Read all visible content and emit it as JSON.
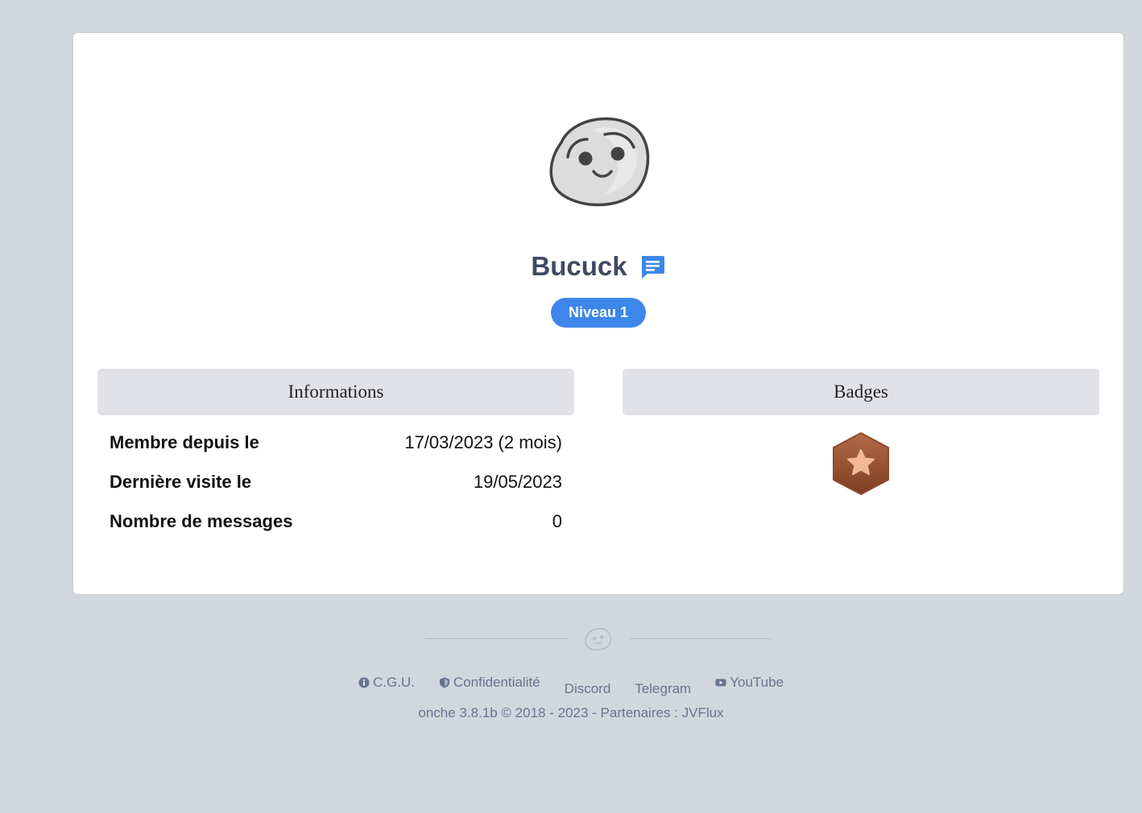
{
  "profile": {
    "username": "Bucuck",
    "level": "Niveau 1",
    "avatar_icon": "smiley-avatar-icon",
    "message_icon": "chat-message-icon"
  },
  "panels": {
    "informations_title": "Informations",
    "badges_title": "Badges"
  },
  "info": [
    {
      "label": "Membre depuis le",
      "value": "17/03/2023 (2 mois)"
    },
    {
      "label": "Dernière visite le",
      "value": "19/05/2023"
    },
    {
      "label": "Nombre de messages",
      "value": "0"
    }
  ],
  "badges": [
    {
      "icon": "bronze-star-hexagon-icon",
      "color": "#9a5232"
    }
  ],
  "footer": {
    "links": [
      {
        "label": "C.G.U.",
        "icon": "info-icon"
      },
      {
        "label": "Confidentialité",
        "icon": "shield-icon"
      },
      {
        "label": "Discord",
        "icon": "discord-icon"
      },
      {
        "label": "Telegram",
        "icon": "telegram-icon"
      },
      {
        "label": "YouTube",
        "icon": "youtube-icon"
      }
    ],
    "credit_prefix": "onche 3.8.1b © 2018 - 2023 - Partenaires :",
    "partner": "JVFlux"
  },
  "colors": {
    "background": "#d2d6de",
    "accent": "#3d86ea",
    "username": "#3f4a62",
    "panel_header": "#e1e2e7",
    "footer_text": "#68748f"
  }
}
